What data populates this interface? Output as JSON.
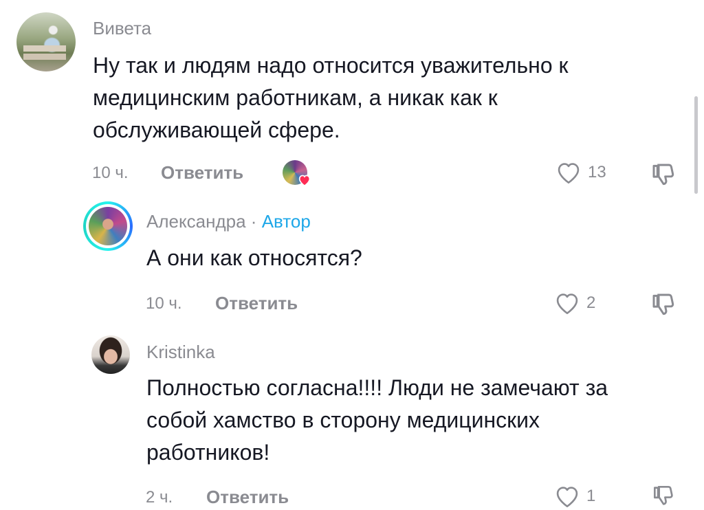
{
  "comments": [
    {
      "username": "Вивета",
      "text_lines": [
        "Ну так и людям надо относится уважительно к",
        "медицинским работникам, а никак как к",
        "обслуживающей сфере."
      ],
      "time": "10 ч.",
      "reply_label": "Ответить",
      "likes": "13"
    },
    {
      "username": "Александра",
      "separator": "·",
      "author_tag": "Автор",
      "text_lines": [
        "А они как относятся?"
      ],
      "time": "10 ч.",
      "reply_label": "Ответить",
      "likes": "2"
    },
    {
      "username": "Kristinka",
      "text_lines": [
        "Полностью согласна!!!! Люди не замечают за",
        "собой хамство в сторону медицинских",
        "работников!"
      ],
      "time": "2 ч.",
      "reply_label": "Ответить",
      "likes": "1"
    }
  ],
  "colors": {
    "text": "#161823",
    "muted": "#8a8b91",
    "author_tag": "#1ea7e8",
    "heart_badge": "#fe2c55",
    "story_ring": "#25f4ee"
  },
  "icons": {
    "like": "heart-outline-icon",
    "dislike": "thumb-down-outline-icon",
    "liked_by_creator": "creator-heart-badge-icon"
  }
}
